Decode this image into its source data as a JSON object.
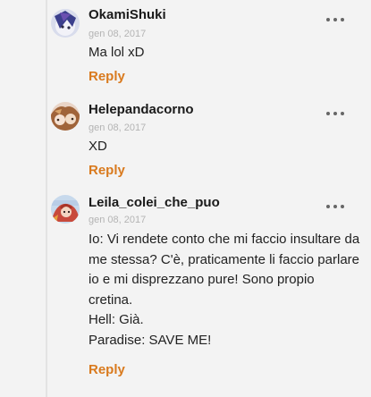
{
  "comments": [
    {
      "username": "OkamiShuki",
      "date": "gen 08, 2017",
      "lines": [
        "Ma lol xD"
      ],
      "reply_label": "Reply",
      "avatar": "avatar-okamishuki",
      "more_icon": "more-dots-icon"
    },
    {
      "username": "Helepandacorno",
      "date": "gen 08, 2017",
      "lines": [
        "XD"
      ],
      "reply_label": "Reply",
      "avatar": "avatar-helepandacorno",
      "more_icon": "more-dots-icon"
    },
    {
      "username": "Leila_colei_che_puo",
      "date": "gen 08, 2017",
      "lines": [
        "Io: Vi rendete conto che mi faccio insultare da",
        "me stessa? C'è, praticamente li faccio parlare",
        "io e mi disprezzano pure! Sono propio",
        "cretina.",
        "Hell: Già.",
        "Paradise: SAVE ME!"
      ],
      "reply_label": "Reply",
      "avatar": "avatar-leila",
      "more_icon": "more-dots-icon"
    }
  ],
  "colors": {
    "reply": "#d97a1e",
    "username": "#1a1a1a",
    "date": "#b4b4b4",
    "thread_line": "#e3e3e3"
  }
}
